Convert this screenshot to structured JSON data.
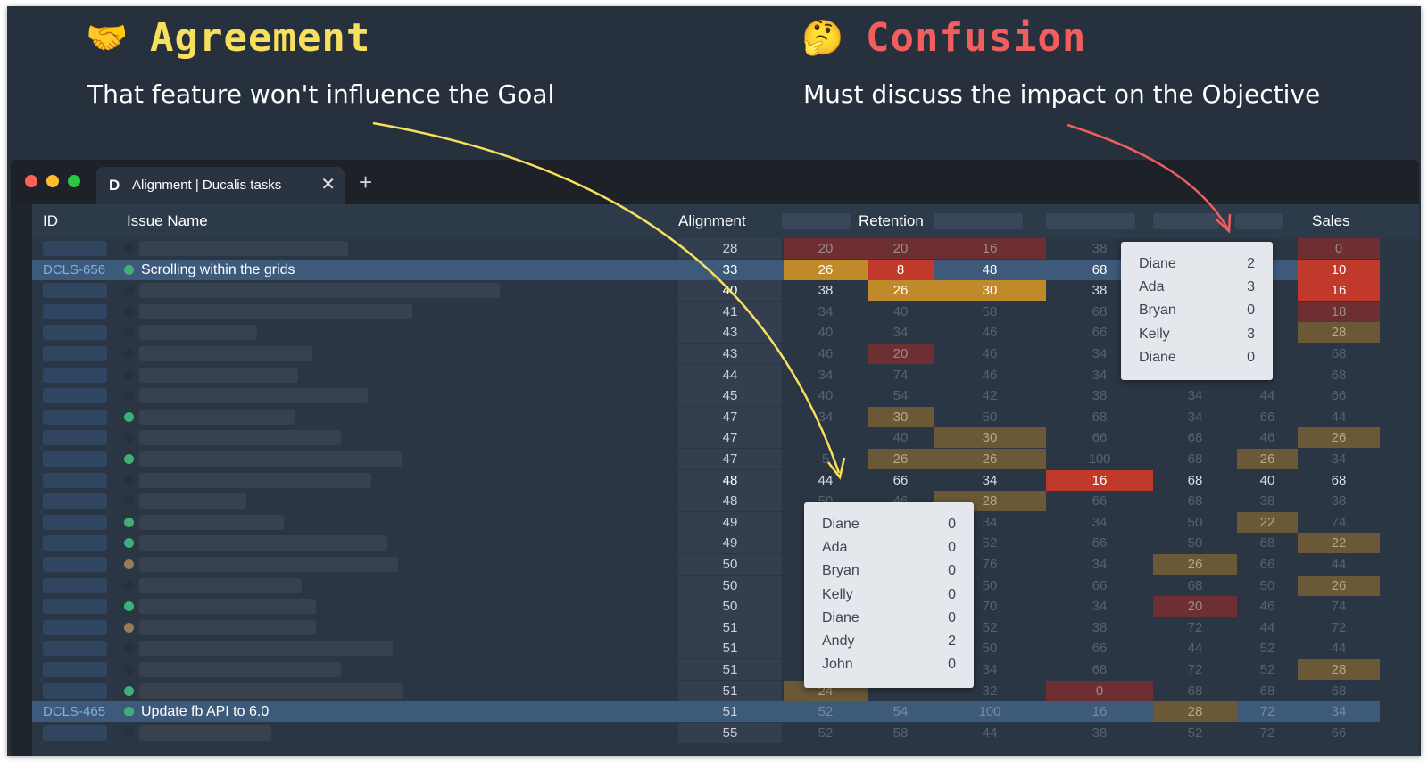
{
  "header": {
    "agreement": {
      "emoji": "🤝",
      "title": "Agreement",
      "subtitle": "That feature won't influence the Goal",
      "color": "#f6e05e"
    },
    "confusion": {
      "emoji": "🤔",
      "title": "Confusion",
      "subtitle": "Must discuss the impact on the Objective",
      "color": "#f25d5d"
    }
  },
  "browser": {
    "tab_title": "Alignment | Ducalis tasks",
    "tab_logo": "D",
    "close_symbol": "✕",
    "new_tab_symbol": "+"
  },
  "columns": {
    "id": "ID",
    "issue_name": "Issue Name",
    "alignment": "Alignment",
    "retention": "Retention",
    "sales": "Sales"
  },
  "rows": [
    {
      "alignment": "28",
      "scores": [
        "20",
        "20",
        "16",
        "38",
        "",
        "",
        "0"
      ]
    },
    {
      "id": "DCLS-656",
      "name": "Scrolling within the grids",
      "alignment": "33",
      "scores": [
        "26",
        "8",
        "48",
        "68",
        "",
        "",
        "10"
      ]
    },
    {
      "alignment": "40",
      "scores": [
        "38",
        "26",
        "30",
        "38",
        "",
        "",
        "16"
      ]
    },
    {
      "alignment": "41",
      "scores": [
        "34",
        "40",
        "58",
        "68",
        "",
        "",
        "18"
      ]
    },
    {
      "alignment": "43",
      "scores": [
        "40",
        "34",
        "46",
        "66",
        "",
        "",
        "28"
      ]
    },
    {
      "alignment": "43",
      "scores": [
        "46",
        "20",
        "46",
        "34",
        "",
        "",
        "68"
      ]
    },
    {
      "alignment": "44",
      "scores": [
        "34",
        "74",
        "46",
        "34",
        "",
        "",
        "68"
      ]
    },
    {
      "alignment": "45",
      "scores": [
        "40",
        "54",
        "42",
        "38",
        "34",
        "44",
        "66"
      ]
    },
    {
      "alignment": "47",
      "scores": [
        "34",
        "30",
        "50",
        "68",
        "34",
        "66",
        "44"
      ]
    },
    {
      "alignment": "47",
      "scores": [
        "",
        "40",
        "30",
        "66",
        "68",
        "46",
        "26"
      ]
    },
    {
      "alignment": "47",
      "scores": [
        "5",
        "26",
        "26",
        "100",
        "68",
        "26",
        "34"
      ]
    },
    {
      "alignment": "48",
      "scores": [
        "44",
        "66",
        "34",
        "16",
        "68",
        "40",
        "68"
      ]
    },
    {
      "alignment": "48",
      "scores": [
        "50",
        "46",
        "28",
        "66",
        "68",
        "38",
        "38"
      ]
    },
    {
      "alignment": "49",
      "scores": [
        "",
        "",
        "34",
        "34",
        "50",
        "22",
        "74"
      ]
    },
    {
      "alignment": "49",
      "scores": [
        "",
        "",
        "52",
        "66",
        "50",
        "68",
        "22"
      ]
    },
    {
      "alignment": "50",
      "scores": [
        "",
        "",
        "76",
        "34",
        "26",
        "66",
        "44"
      ]
    },
    {
      "alignment": "50",
      "scores": [
        "",
        "",
        "50",
        "66",
        "68",
        "50",
        "26"
      ]
    },
    {
      "alignment": "50",
      "scores": [
        "",
        "",
        "70",
        "34",
        "20",
        "46",
        "74"
      ]
    },
    {
      "alignment": "51",
      "scores": [
        "",
        "",
        "52",
        "38",
        "72",
        "44",
        "72"
      ]
    },
    {
      "alignment": "51",
      "scores": [
        "",
        "",
        "50",
        "66",
        "44",
        "52",
        "44"
      ]
    },
    {
      "alignment": "51",
      "scores": [
        "",
        "",
        "34",
        "68",
        "72",
        "52",
        "28"
      ]
    },
    {
      "alignment": "51",
      "scores": [
        "24",
        "",
        "32",
        "0",
        "68",
        "68",
        "68"
      ]
    },
    {
      "id": "DCLS-465",
      "name": "Update fb API to 6.0",
      "alignment": "51",
      "scores": [
        "52",
        "54",
        "100",
        "16",
        "28",
        "72",
        "34"
      ]
    },
    {
      "alignment": "55",
      "scores": [
        "52",
        "58",
        "44",
        "38",
        "52",
        "72",
        "66"
      ]
    }
  ],
  "popup_sales": [
    {
      "name": "Diane",
      "value": "2"
    },
    {
      "name": "Ada",
      "value": "3"
    },
    {
      "name": "Bryan",
      "value": "0"
    },
    {
      "name": "Kelly",
      "value": "3"
    },
    {
      "name": "Diane",
      "value": "0"
    }
  ],
  "popup_retention": [
    {
      "name": "Diane",
      "value": "0"
    },
    {
      "name": "Ada",
      "value": "0"
    },
    {
      "name": "Bryan",
      "value": "0"
    },
    {
      "name": "Kelly",
      "value": "0"
    },
    {
      "name": "Diane",
      "value": "0"
    },
    {
      "name": "Andy",
      "value": "2"
    },
    {
      "name": "John",
      "value": "0"
    }
  ],
  "colors": {
    "agreement_arrow": "#f6e05e",
    "confusion_arrow": "#f25d5d",
    "highlight_row": "#3d5a7a",
    "red_cell": "#c0392b",
    "orange_cell": "#c08a2a"
  }
}
